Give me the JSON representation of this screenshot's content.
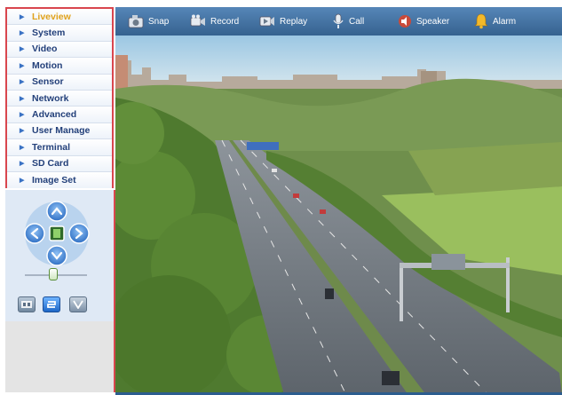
{
  "menu": {
    "items": [
      {
        "label": "Liveview",
        "active": true
      },
      {
        "label": "System"
      },
      {
        "label": "Video"
      },
      {
        "label": "Motion"
      },
      {
        "label": "Sensor"
      },
      {
        "label": "Network"
      },
      {
        "label": "Advanced"
      },
      {
        "label": "User Manage"
      },
      {
        "label": "Terminal"
      },
      {
        "label": "SD Card"
      },
      {
        "label": "Image Set"
      }
    ]
  },
  "toolbar": {
    "snap": "Snap",
    "record": "Record",
    "replay": "Replay",
    "call": "Call",
    "speaker": "Speaker",
    "alarm": "Alarm"
  },
  "ptz": {
    "zoom_level": 0.45
  },
  "colors": {
    "toolbar": "#4677a8",
    "menu_border": "#d9464e",
    "menu_text": "#23407a",
    "menu_active": "#e0a21b",
    "ptz_blue": "#3a80d9"
  }
}
